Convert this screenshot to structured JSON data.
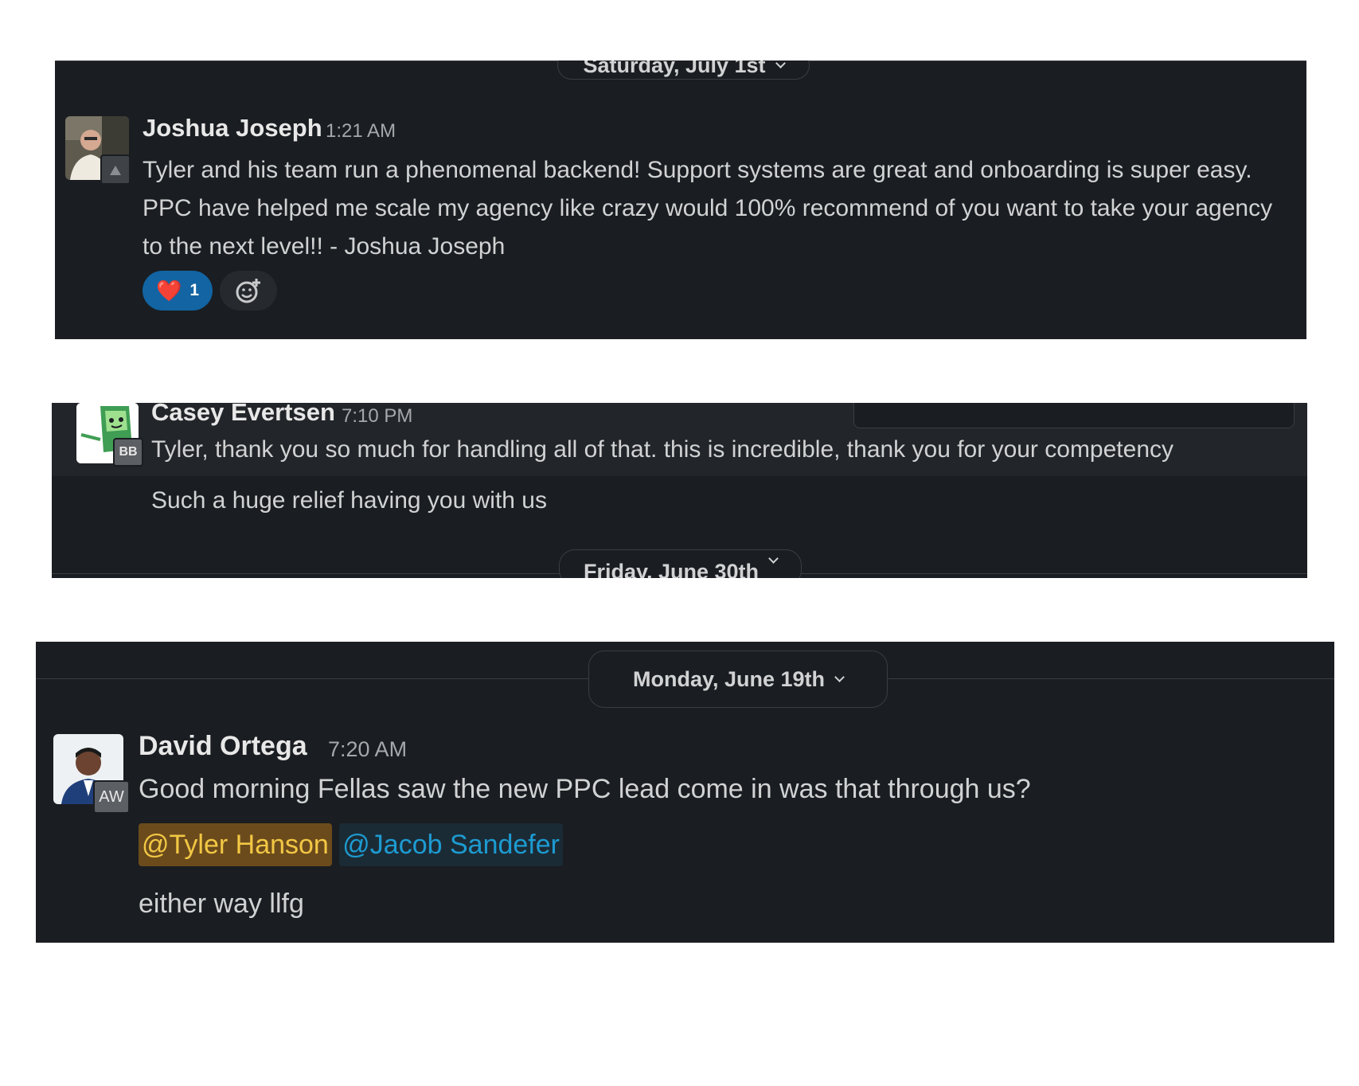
{
  "panel1": {
    "date_label": "Saturday, July 1st",
    "author": "Joshua Joseph",
    "time": "1:21 AM",
    "message": "Tyler and his team run a phenomenal backend! Support systems are great and onboarding is super easy. PPC have helped me scale my agency like crazy would 100% recommend of you want to take your agency to the next level!! - Joshua Joseph",
    "reaction_emoji": "❤️",
    "reaction_count": "1",
    "add_reaction_icon": "add-emoji-icon"
  },
  "panel2": {
    "author": "Casey Evertsen",
    "time": "7:10 PM",
    "badge": "BB",
    "message1": "Tyler, thank you so much for handling all of that. this is incredible, thank you for your competency",
    "message2": "Such a huge relief having you with us",
    "date_label": "Friday, June 30th"
  },
  "panel3": {
    "date_label": "Monday, June 19th",
    "author": "David Ortega",
    "time": "7:20 AM",
    "badge": "AW",
    "message": "Good morning Fellas saw the new PPC lead come in was that through us?",
    "mention1": "@Tyler Hanson",
    "mention2": "@Jacob Sandefer",
    "message2": "either way llfg"
  },
  "colors": {
    "panel_bg": "#1a1d21",
    "mention_self_bg": "#6b4b1c",
    "mention_self_fg": "#f2c744",
    "mention_other_bg": "#1b2b36",
    "mention_other_fg": "#1d9bd1",
    "reaction_active_bg": "#1264a3"
  }
}
